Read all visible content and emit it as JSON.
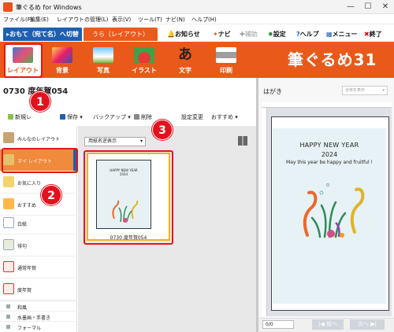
{
  "window": {
    "title": "筆ぐるめ for Windows",
    "controls": [
      "—",
      "☐",
      "✕"
    ]
  },
  "menubar": [
    "ファイル(F)",
    "編集(E)",
    "レイアウトの管理(L)",
    "表示(V)",
    "ツール(T)",
    "ナビ(N)",
    "ヘルプ(H)"
  ],
  "mode_tabs": {
    "address": "▸おもて（宛て名）へ切替",
    "front": "うら（レイアウト）"
  },
  "top_links": {
    "news": "お知らせ",
    "navi": "ナビ",
    "assist": "補助",
    "settings": "設定",
    "help": "ヘルプ",
    "menu": "メニュー",
    "exit": "終了"
  },
  "ribbon": {
    "buttons": [
      "レイアウト",
      "背景",
      "写真",
      "イラスト",
      "文字",
      "印刷"
    ],
    "brand": "筆ぐるめ31"
  },
  "document_title": "0730 度年賀054",
  "toolbar": {
    "new": "新規レ",
    "save": "保存",
    "backup": "バックアップ",
    "delete": "削除",
    "layout_change": "設定変更",
    "recommend": "おすすめ"
  },
  "sidebar": {
    "items": [
      "みんなのレイアウト",
      "マイ レイアウト",
      "お気に入り",
      "おすすめ",
      "白紙",
      "俳句",
      "通常年賀",
      "度年賀"
    ],
    "sub_items": [
      "和風",
      "水墨画・手書き",
      "フォーマル"
    ]
  },
  "grid": {
    "sort_label": "用紙名逆表示",
    "card_label": "0730 度年賀054",
    "card_preview_lines": [
      "HAPPY NEW YEAR",
      "2024"
    ]
  },
  "preview": {
    "paper_type": "はがき",
    "zoom_placeholder": "全体を表示",
    "card_lines": [
      "HAPPY NEW YEAR",
      "2024",
      "May this year be happy and fruitful !"
    ],
    "page_field": "0/0",
    "prev": "|◀ 前へ",
    "next": "次へ ▶|"
  },
  "callouts": [
    "1",
    "2",
    "3"
  ],
  "colors": {
    "ribbon": "#e9591a",
    "address_tab": "#1f5fb0",
    "highlight": "#e01818",
    "selection": "#f3b316"
  }
}
